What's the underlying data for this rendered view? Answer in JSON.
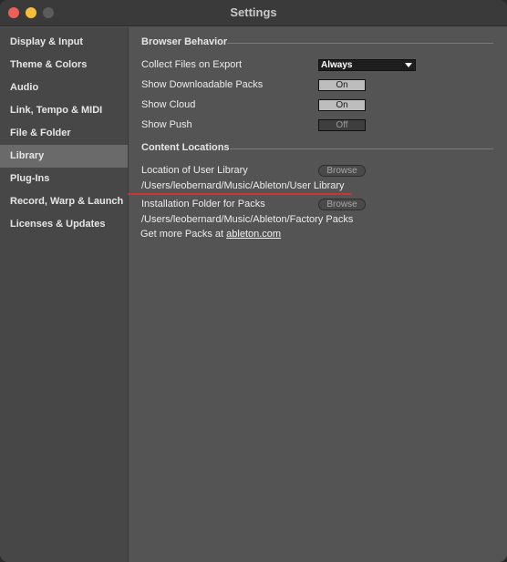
{
  "window": {
    "title": "Settings"
  },
  "sidebar": {
    "items": [
      {
        "label": "Display & Input",
        "active": false
      },
      {
        "label": "Theme & Colors",
        "active": false
      },
      {
        "label": "Audio",
        "active": false
      },
      {
        "label": "Link, Tempo & MIDI",
        "active": false
      },
      {
        "label": "File & Folder",
        "active": false
      },
      {
        "label": "Library",
        "active": true
      },
      {
        "label": "Plug-Ins",
        "active": false
      },
      {
        "label": "Record, Warp & Launch",
        "active": false
      },
      {
        "label": "Licenses & Updates",
        "active": false
      }
    ]
  },
  "browser_behavior": {
    "heading": "Browser Behavior",
    "collect_files": {
      "label": "Collect Files on Export",
      "value": "Always"
    },
    "show_downloadable_packs": {
      "label": "Show Downloadable Packs",
      "value": "On"
    },
    "show_cloud": {
      "label": "Show Cloud",
      "value": "On"
    },
    "show_push": {
      "label": "Show Push",
      "value": "Off"
    }
  },
  "content_locations": {
    "heading": "Content Locations",
    "user_library": {
      "label": "Location of User Library",
      "button": "Browse",
      "path": "/Users/leobernard/Music/Ableton/User Library"
    },
    "packs_folder": {
      "label": "Installation Folder for Packs",
      "button": "Browse",
      "path": "/Users/leobernard/Music/Ableton/Factory Packs"
    },
    "more_packs": {
      "prefix": "Get more Packs at ",
      "link": "ableton.com"
    }
  },
  "colors": {
    "annotation_underline": "#cf3232",
    "active_sidebar": "#6a6a6a",
    "toggle_on": "#bdbdbd"
  }
}
